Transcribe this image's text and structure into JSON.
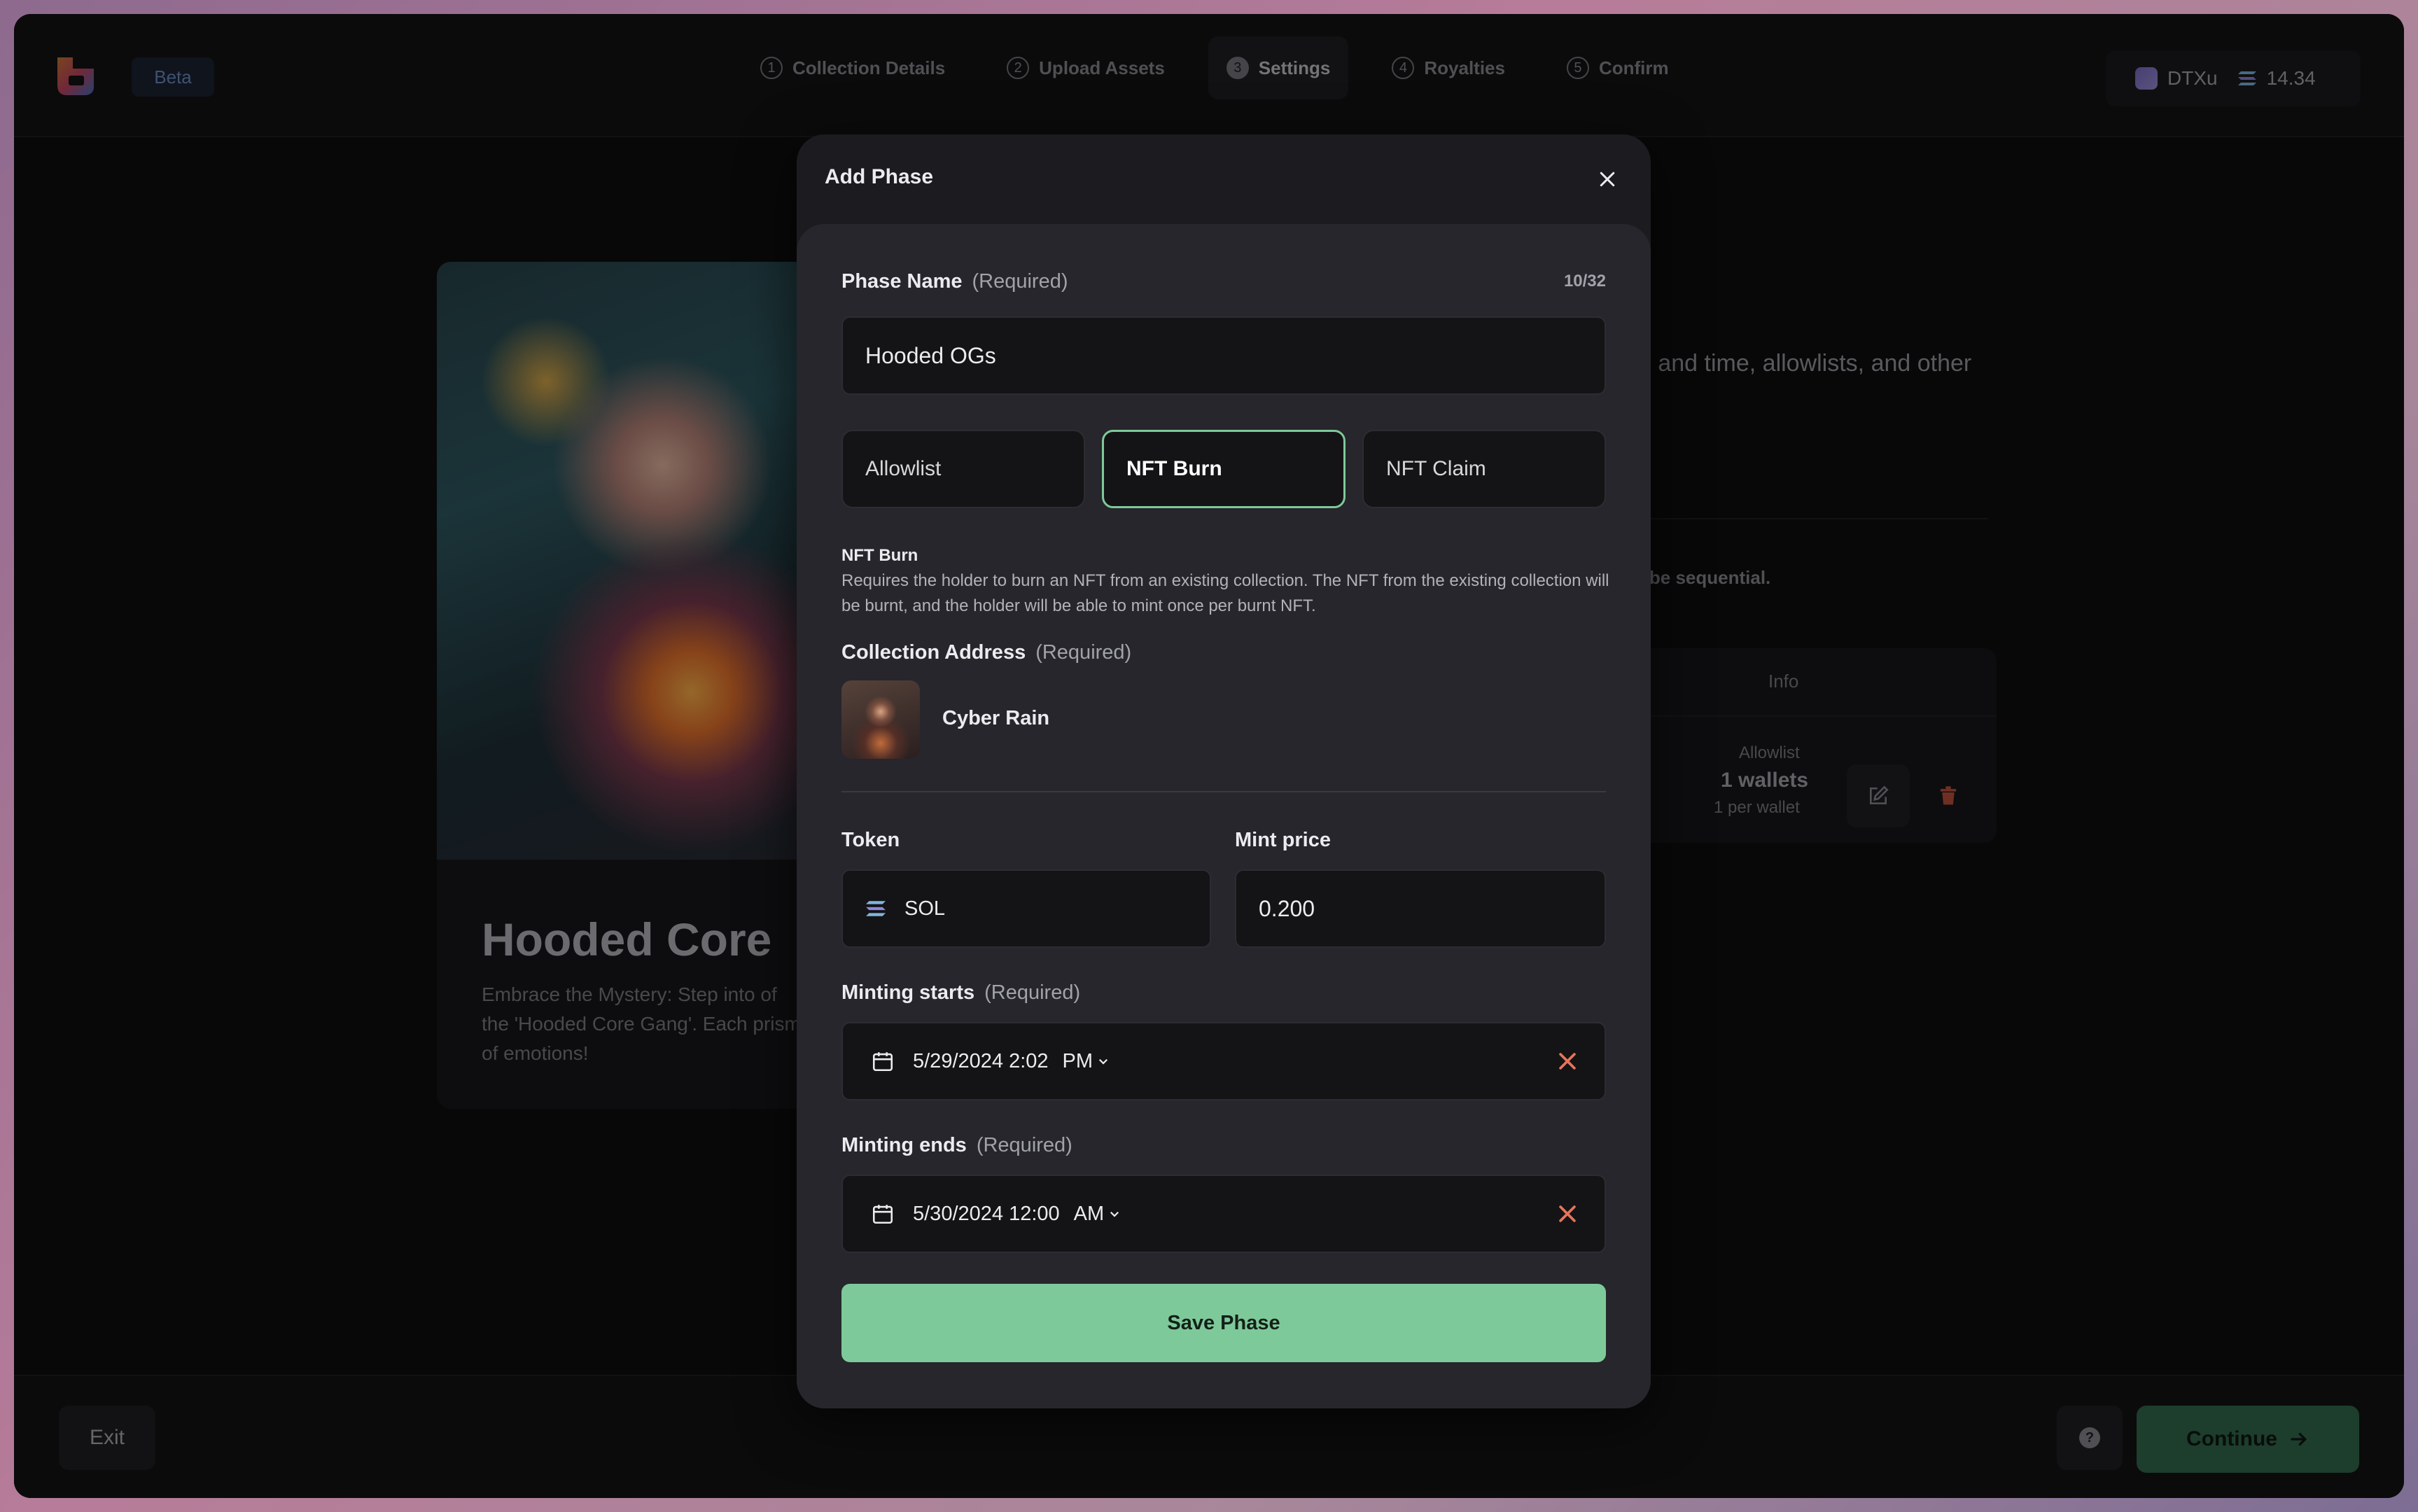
{
  "topbar": {
    "beta_label": "Beta",
    "steps": [
      {
        "num": "1",
        "label": "Collection Details"
      },
      {
        "num": "2",
        "label": "Upload Assets"
      },
      {
        "num": "3",
        "label": "Settings"
      },
      {
        "num": "4",
        "label": "Royalties"
      },
      {
        "num": "5",
        "label": "Confirm"
      }
    ],
    "wallet_name": "DTXu",
    "balance": "14.34"
  },
  "background": {
    "card_title": "Hooded Core",
    "card_description": "Embrace the Mystery: Step into of the 'Hooded Core Gang'. Each prism of emotions!",
    "intro_text": "e and time, allowlists, and other",
    "note_text": "t be sequential.",
    "table_header_info": "Info",
    "row_type": "Allowlist",
    "row_wallets": "1 wallets",
    "row_limit": "1 per wallet"
  },
  "modal": {
    "title": "Add Phase",
    "phase_name_label": "Phase Name",
    "required_label": "(Required)",
    "phase_name_counter": "10/32",
    "phase_name_value": "Hooded OGs",
    "phase_types": [
      {
        "label": "Allowlist",
        "selected": false
      },
      {
        "label": "NFT Burn",
        "selected": true
      },
      {
        "label": "NFT Claim",
        "selected": false
      }
    ],
    "type_desc_title": "NFT Burn",
    "type_desc_text": "Requires the holder to burn an NFT from an existing collection. The NFT from the existing collection will be burnt, and the holder will be able to mint once per burnt NFT.",
    "collection_address_label": "Collection Address",
    "collection_name": "Cyber Rain",
    "token_label": "Token",
    "token_value": "SOL",
    "mint_price_label": "Mint price",
    "mint_price_value": "0.200",
    "minting_starts_label": "Minting starts",
    "minting_starts_date": "5/29/2024 2:02",
    "minting_starts_ampm": "PM",
    "minting_ends_label": "Minting ends",
    "minting_ends_date": "5/30/2024 12:00",
    "minting_ends_ampm": "AM",
    "save_label": "Save Phase"
  },
  "bottombar": {
    "exit_label": "Exit",
    "help_label": "?",
    "continue_label": "Continue"
  },
  "colors": {
    "accent": "#7ec99a",
    "danger": "#e8735a"
  }
}
